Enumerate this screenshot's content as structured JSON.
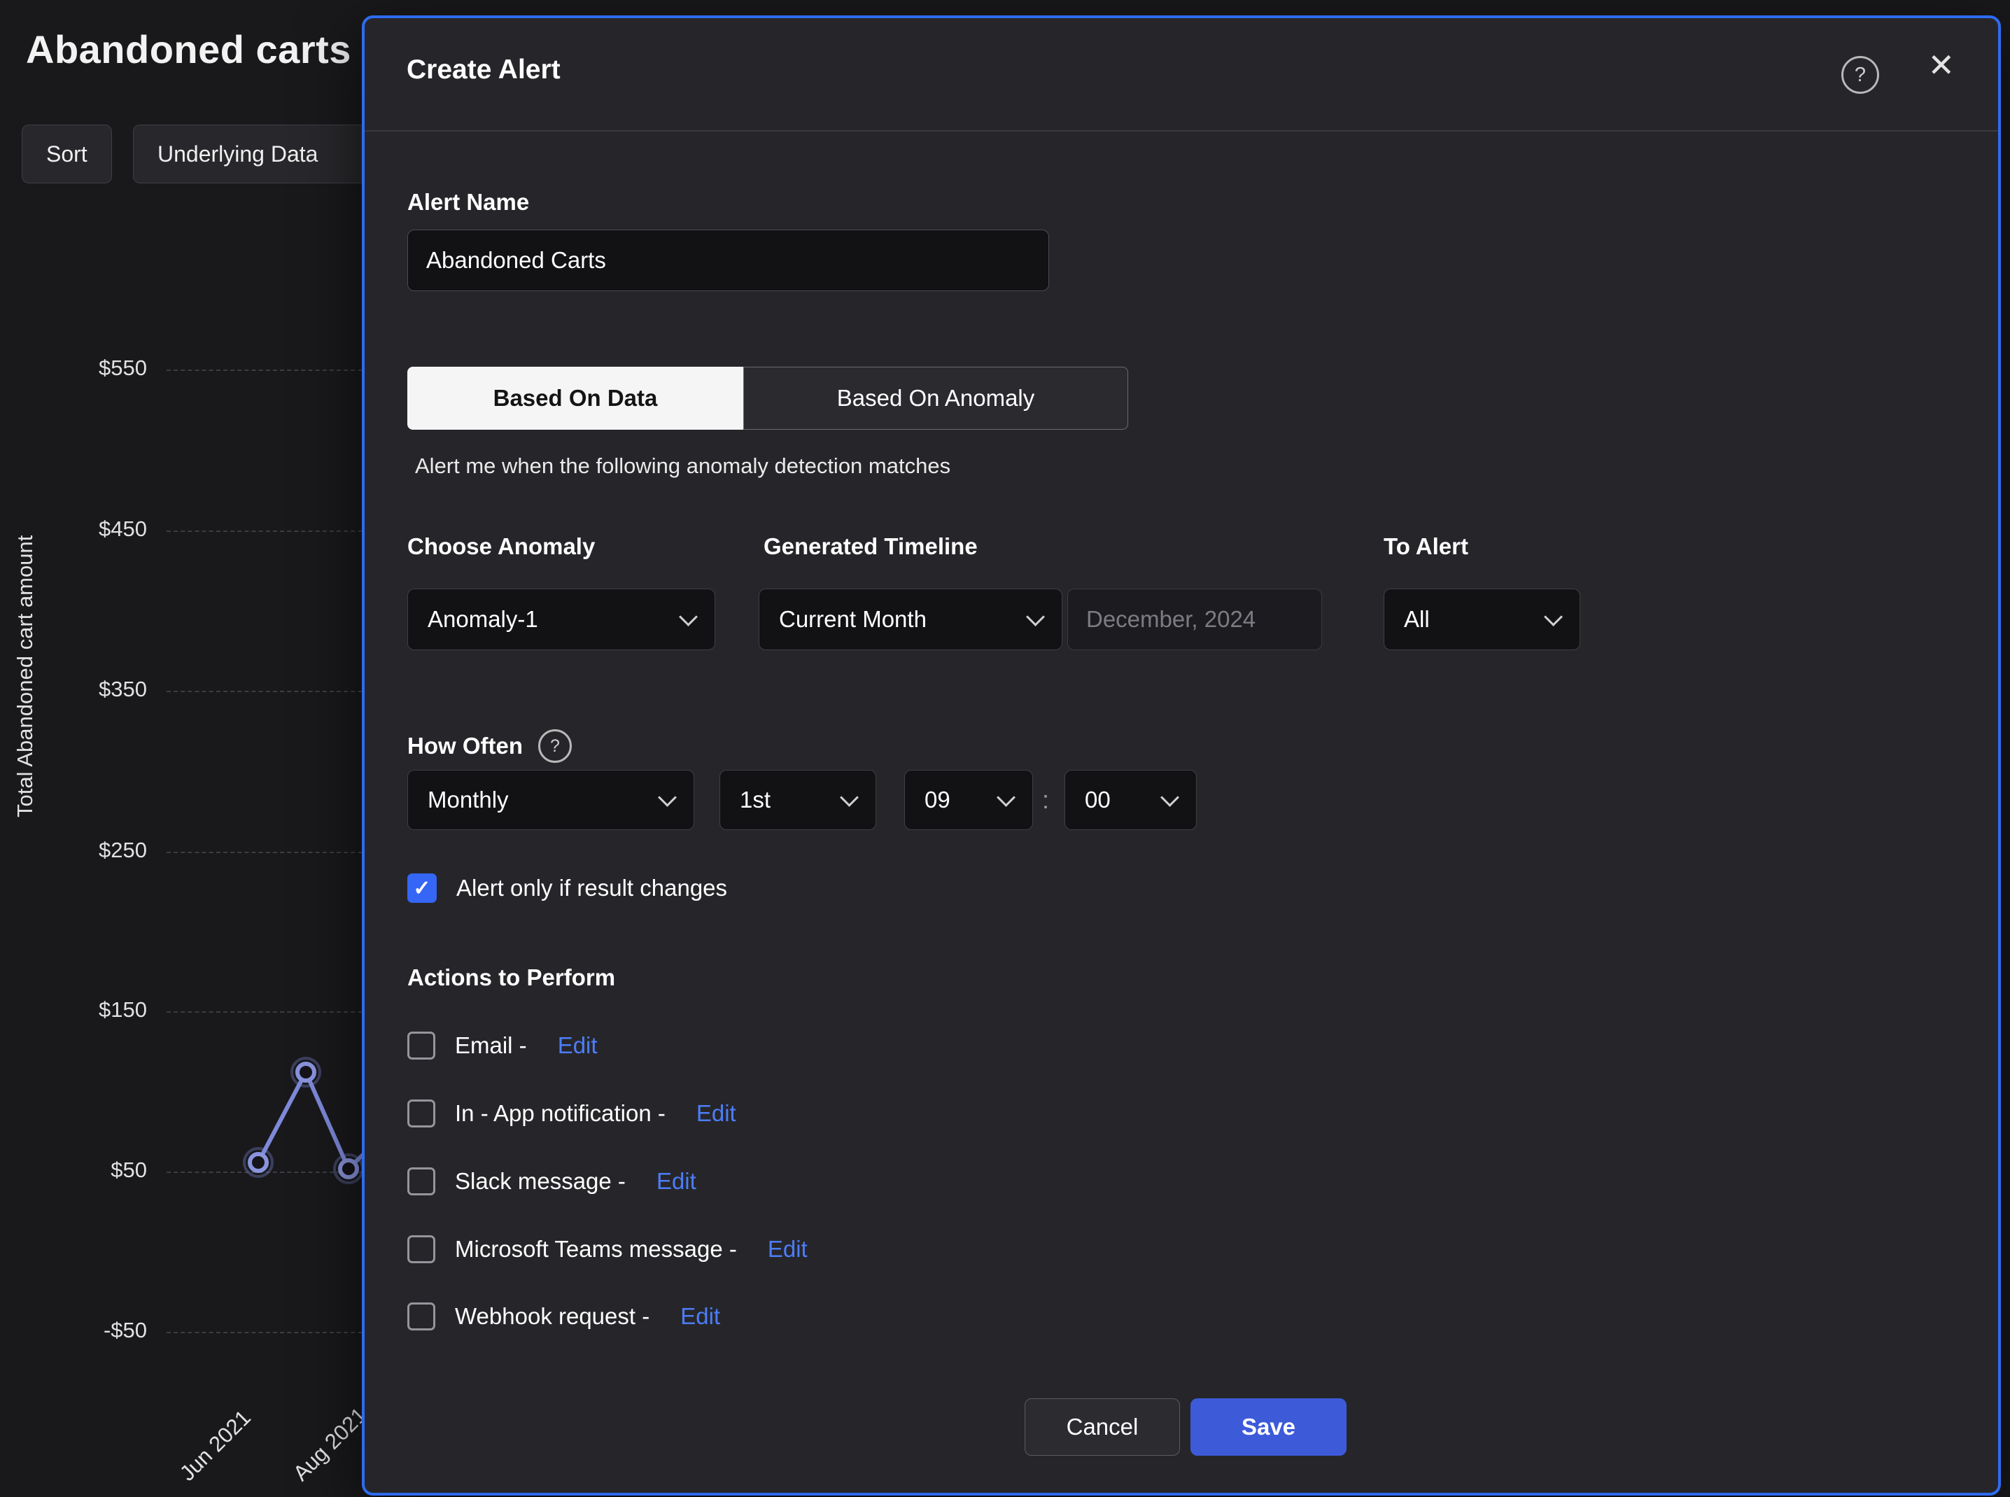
{
  "page": {
    "title": "Abandoned carts"
  },
  "toolbar": {
    "sort": "Sort",
    "underlying_data": "Underlying Data"
  },
  "chart": {
    "y_axis_title": "Total Abandoned cart amount",
    "y_ticks": [
      "$550",
      "$450",
      "$350",
      "$250",
      "$150",
      "$50",
      "-$50"
    ],
    "x_ticks": [
      "Jun 2021",
      "Aug 2021"
    ]
  },
  "modal": {
    "title": "Create Alert",
    "help_icon": "?",
    "close_icon": "✕",
    "alert_name_label": "Alert Name",
    "alert_name_value": "Abandoned Carts",
    "tabs": {
      "data": "Based On Data",
      "anomaly": "Based On Anomaly"
    },
    "subtitle": "Alert me when the following anomaly detection matches",
    "choose_anomaly_label": "Choose Anomaly",
    "choose_anomaly_value": "Anomaly-1",
    "generated_timeline_label": "Generated Timeline",
    "generated_timeline_value": "Current Month",
    "generated_timeline_date": "December, 2024",
    "to_alert_label": "To Alert",
    "to_alert_value": "All",
    "how_often_label": "How Often",
    "frequency": "Monthly",
    "day": "1st",
    "hour": "09",
    "minute": "00",
    "time_separator": ":",
    "check_glyph": "✓",
    "result_changes_label": "Alert only if result changes",
    "actions_label": "Actions to Perform",
    "actions": [
      {
        "label": "Email -",
        "edit": "Edit"
      },
      {
        "label": "In - App notification -",
        "edit": "Edit"
      },
      {
        "label": "Slack message -",
        "edit": "Edit"
      },
      {
        "label": "Microsoft Teams message -",
        "edit": "Edit"
      },
      {
        "label": "Webhook request -",
        "edit": "Edit"
      }
    ],
    "cancel": "Cancel",
    "save": "Save"
  },
  "colors": {
    "accent_border": "#2e6bf0",
    "save_button": "#3d5bd9",
    "link": "#4d7df8",
    "checkbox_checked": "#3566f5",
    "chart_line": "#7e89d9"
  }
}
